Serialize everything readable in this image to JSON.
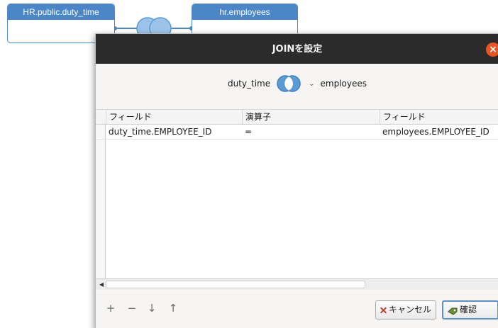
{
  "canvas": {
    "left_table": "HR.public.duty_time",
    "right_table": "hr.employees"
  },
  "dialog": {
    "title": "JOINを設定",
    "left_table": "duty_time",
    "right_table": "employees",
    "join_icon": "full-outer-join-icon",
    "columns": [
      "フィールド",
      "演算子",
      "フィールド"
    ],
    "rows": [
      {
        "left_field": "duty_time.EMPLOYEE_ID",
        "operator": "=",
        "right_field": "employees.EMPLOYEE_ID"
      }
    ],
    "tools": {
      "add": "+",
      "remove": "−",
      "move_down": "↓",
      "move_up": "↑"
    },
    "cancel_label": "キャンセル",
    "ok_label": "確認"
  },
  "colors": {
    "table_header": "#4a86c8",
    "titlebar": "#2b2b2b",
    "close": "#e95420",
    "join_blue": "#5b9bd5"
  }
}
